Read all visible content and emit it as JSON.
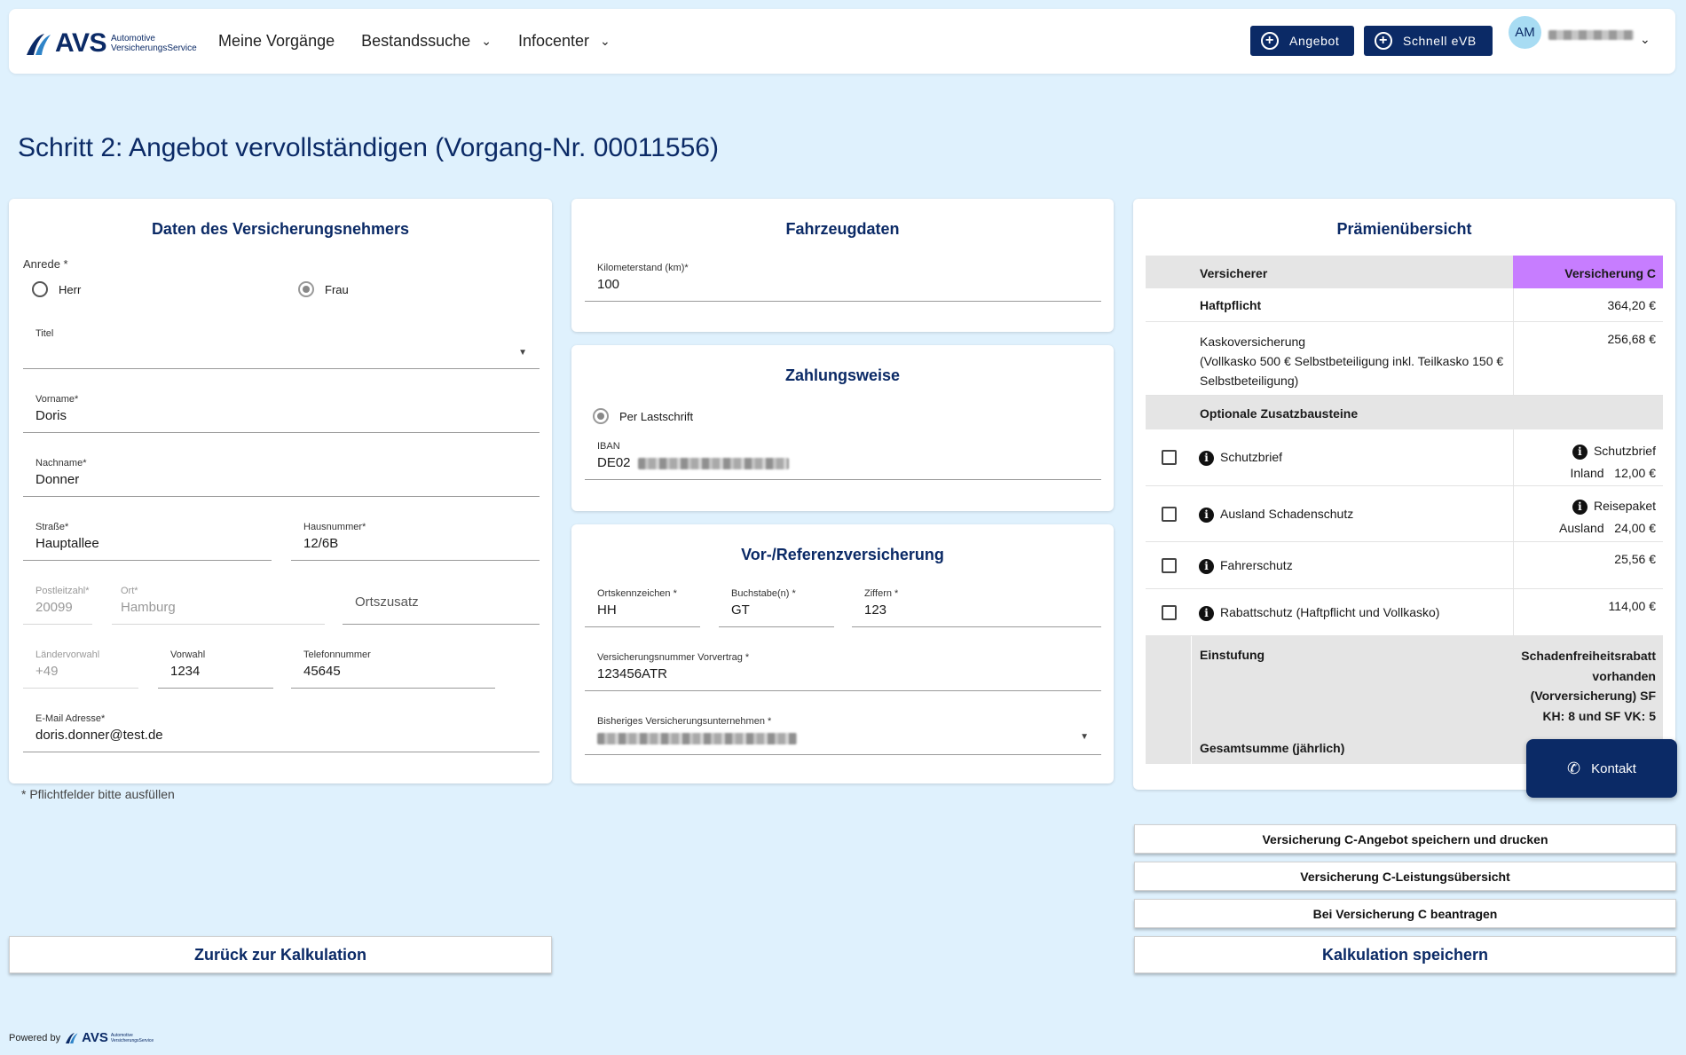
{
  "header": {
    "logo_text": "AVS",
    "logo_sub_line1": "Automotive",
    "logo_sub_line2": "VersicherungsService",
    "nav": [
      {
        "label": "Meine Vorgänge"
      },
      {
        "label": "Bestandssuche"
      },
      {
        "label": "Infocenter"
      }
    ],
    "btn_angebot": "Angebot",
    "btn_schnell": "Schnell eVB",
    "avatar_initials": "AM"
  },
  "page_title": "Schritt 2: Angebot vervollständigen (Vorgang-Nr. 00011556)",
  "vn": {
    "title": "Daten des Versicherungsnehmers",
    "anrede_label": "Anrede *",
    "anrede_options": [
      "Herr",
      "Frau"
    ],
    "anrede_selected": "Frau",
    "titel_label": "Titel",
    "vorname_label": "Vorname*",
    "vorname": "Doris",
    "nachname_label": "Nachname*",
    "nachname": "Donner",
    "strasse_label": "Straße*",
    "strasse": "Hauptallee",
    "hausnummer_label": "Hausnummer*",
    "hausnummer": "12/6B",
    "plz_label": "Postleitzahl*",
    "plz": "20099",
    "ort_label": "Ort*",
    "ort": "Hamburg",
    "ortszusatz_placeholder": "Ortszusatz",
    "laendervorwahl_label": "Ländervorwahl",
    "laendervorwahl": "+49",
    "vorwahl_label": "Vorwahl",
    "vorwahl": "1234",
    "telefon_label": "Telefonnummer",
    "telefon": "45645",
    "email_label": "E-Mail Adresse*",
    "email": "doris.donner@test.de",
    "footnote": "* Pflichtfelder bitte ausfüllen"
  },
  "fahrzeug": {
    "title": "Fahrzeugdaten",
    "km_label": "Kilometerstand (km)*",
    "km": "100"
  },
  "zahlung": {
    "title": "Zahlungsweise",
    "option": "Per Lastschrift",
    "iban_label": "IBAN",
    "iban_prefix": "DE02"
  },
  "vorvers": {
    "title": "Vor-/Referenzversicherung",
    "ortskennzeichen_label": "Ortskennzeichen *",
    "ortskennzeichen": "HH",
    "buchstaben_label": "Buchstabe(n) *",
    "buchstaben": "GT",
    "ziffern_label": "Ziffern *",
    "ziffern": "123",
    "vsnr_label": "Versicherungsnummer Vorvertrag *",
    "vsnr": "123456ATR",
    "vu_label": "Bisheriges Versicherungsunternehmen *"
  },
  "praemie": {
    "title": "Prämienübersicht",
    "header_left": "Versicherer",
    "header_right": "Versicherung C",
    "header_right_color": "#c77dff",
    "haftpflicht_label": "Haftpflicht",
    "haftpflicht_value": "364,20 €",
    "kasko_label": "Kaskoversicherung",
    "kasko_detail": "(Vollkasko 500 € Selbstbeteiligung inkl. Teilkasko 150 € Selbstbeteiligung)",
    "kasko_value": "256,68 €",
    "optional_label": "Optionale Zusatzbausteine",
    "options": [
      {
        "label": "Schutzbrief",
        "right_line1": "Schutzbrief",
        "right_line2a": "Inland",
        "right_line2b": "12,00 €"
      },
      {
        "label": "Ausland Schadenschutz",
        "right_line1": "Reisepaket",
        "right_line2a": "Ausland",
        "right_line2b": "24,00 €"
      },
      {
        "label": "Fahrerschutz",
        "value": "25,56 €"
      },
      {
        "label": "Rabattschutz (Haftpflicht und Vollkasko)",
        "value": "114,00 €"
      }
    ],
    "einstufung_label": "Einstufung",
    "einstufung_value": "Schadenfreiheitsrabatt vorhanden (Vorversicherung) SF KH: 8 und SF VK: 5",
    "gesamt_label": "Gesamtsumme (jährlich)"
  },
  "actions": {
    "save_print": "Versicherung C-Angebot speichern und drucken",
    "leistung": "Versicherung C-Leistungsübersicht",
    "beantragen": "Bei Versicherung C beantragen",
    "kalk_speichern": "Kalkulation speichern",
    "zurueck": "Zurück zur Kalkulation"
  },
  "kontakt": "Kontakt",
  "powered_by": "Powered by",
  "icons": [
    "plus-circle-icon",
    "chevron-down-icon",
    "phone-icon",
    "info-icon",
    "dropdown-caret-icon"
  ]
}
